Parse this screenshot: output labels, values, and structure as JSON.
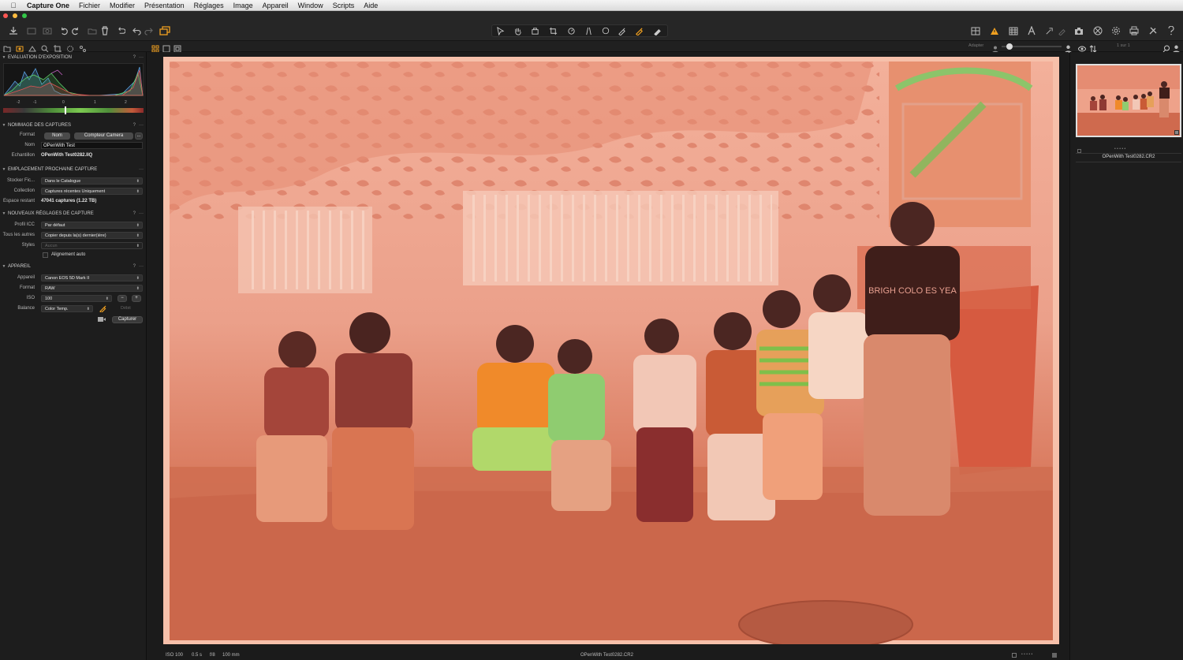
{
  "menubar": {
    "app": "Capture One",
    "items": [
      "Fichier",
      "Modifier",
      "Présentation",
      "Réglages",
      "Image",
      "Appareil",
      "Window",
      "Scripts",
      "Aide"
    ]
  },
  "viewer_header": {
    "fit_label": "Adapter",
    "page_label": "1 sur 1"
  },
  "exposure": {
    "title": "EVALUATION D'EXPOSITION",
    "ticks": [
      "-2",
      "-1",
      "0",
      "1",
      "2"
    ]
  },
  "naming": {
    "title": "NOMMAGE DES CAPTURES",
    "format_label": "Format",
    "format_tokens": [
      "Nom",
      "Compteur Camera"
    ],
    "more": "...",
    "name_label": "Nom",
    "name_value": "OPenWith Test",
    "sample_label": "Echantillon",
    "sample_value": "OPenWith Test0282.IIQ"
  },
  "location": {
    "title": "EMPLACEMENT PROCHAINE CAPTURE",
    "store_label": "Stocker Fic...",
    "store_value": "Dans le Catalogue",
    "collection_label": "Collection",
    "collection_value": "Captures récentes Uniquement",
    "space_label": "Espace restant",
    "space_value": "47041 captures (1.22 TB)"
  },
  "settings": {
    "title": "NOUVEAUX RÉGLAGES DE CAPTURE",
    "icc_label": "Profil ICC",
    "icc_value": "Par défaut",
    "others_label": "Tous les autres",
    "others_value": "Copier depuis la(s) dernier(ière)",
    "styles_label": "Styles",
    "styles_value": "Aucun",
    "auto_align": "Alignement auto"
  },
  "camera": {
    "title": "APPAREIL",
    "device_label": "Appareil",
    "device_value": "Canon EOS 5D Mark II",
    "format_label": "Format",
    "format_value": "RAW",
    "iso_label": "ISO",
    "iso_value": "100",
    "balance_label": "Balance",
    "balance_value": "Color Temp.",
    "debit_label": "Débit",
    "capture_label": "Capturer"
  },
  "status": {
    "iso": "ISO 100",
    "shutter": "0.5 s",
    "aperture": "f/8",
    "focal": "100 mm",
    "filename": "OPenWith Test0282.CR2"
  },
  "browser": {
    "filename": "OPenWith Test0282.CR2",
    "rating_dots": "• • • • •"
  },
  "photo_text": {
    "shirt": "BRIGH COLO ES YEA"
  },
  "colors": {
    "accent_orange": "#f0a020",
    "warning": "#f0a020",
    "negative_base": "#f2a58a",
    "negative_shadow": "#c9624a"
  }
}
